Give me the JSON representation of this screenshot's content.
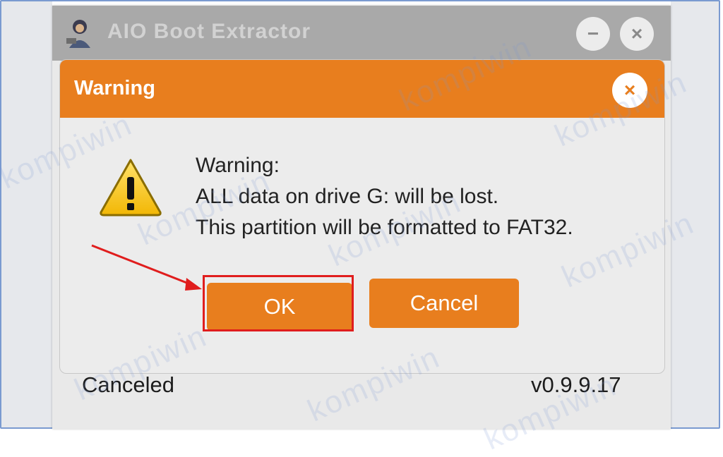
{
  "window": {
    "title": "AIO Boot Extractor",
    "minimize_glyph": "−",
    "close_glyph": "×",
    "status_text": "Canceled",
    "version": "v0.9.9.17"
  },
  "dialog": {
    "title": "Warning",
    "close_glyph": "×",
    "message_lines": [
      "Warning:",
      "ALL data on drive G: will be lost.",
      "This partition will be formatted to FAT32."
    ],
    "ok_label": "OK",
    "cancel_label": "Cancel",
    "icon": "warning-icon"
  },
  "annotation": {
    "highlight_target": "ok-button",
    "color": "#e01d1d"
  },
  "watermark": {
    "text": "kompiwin"
  },
  "colors": {
    "accent": "#e87e1e",
    "titlebar": "#a9a9a9",
    "dialog_bg": "#ececec"
  }
}
